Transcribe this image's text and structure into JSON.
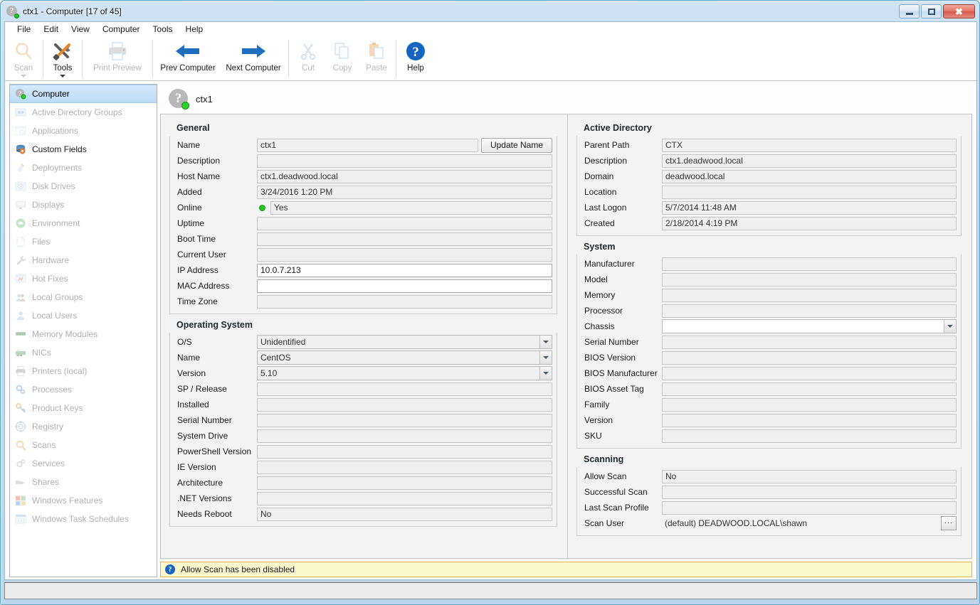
{
  "window": {
    "title": "ctx1 - Computer [17 of 45]",
    "title_icon": "computer-online-icon",
    "minimize_label": "Minimize",
    "maximize_label": "Maximize",
    "close_label": "Close"
  },
  "menu": {
    "items": [
      {
        "label": "File"
      },
      {
        "label": "Edit"
      },
      {
        "label": "View"
      },
      {
        "label": "Computer"
      },
      {
        "label": "Tools"
      },
      {
        "label": "Help"
      }
    ]
  },
  "toolbar": {
    "buttons": [
      {
        "label": "Scan",
        "icon": "magnifier-icon",
        "enabled": false,
        "dropdown": true
      },
      {
        "label": "Tools",
        "icon": "tools-icon",
        "enabled": true,
        "dropdown": true
      },
      {
        "label": "Print Preview",
        "icon": "printer-icon",
        "enabled": false,
        "dropdown": false
      },
      {
        "label": "Prev Computer",
        "icon": "arrow-left-icon",
        "enabled": true,
        "dropdown": false
      },
      {
        "label": "Next Computer",
        "icon": "arrow-right-icon",
        "enabled": true,
        "dropdown": false
      },
      {
        "label": "Cut",
        "icon": "scissors-icon",
        "enabled": false,
        "dropdown": false
      },
      {
        "label": "Copy",
        "icon": "copy-icon",
        "enabled": false,
        "dropdown": false
      },
      {
        "label": "Paste",
        "icon": "paste-icon",
        "enabled": false,
        "dropdown": false
      },
      {
        "label": "Help",
        "icon": "question-mark-icon",
        "enabled": true,
        "dropdown": false
      }
    ]
  },
  "sidebar": {
    "items": [
      {
        "label": "Computer",
        "icon": "computer-icon",
        "enabled": true,
        "selected": true
      },
      {
        "label": "Active Directory Groups",
        "icon": "ad-groups-icon",
        "enabled": false,
        "selected": false
      },
      {
        "label": "Applications",
        "icon": "applications-icon",
        "enabled": false,
        "selected": false
      },
      {
        "label": "Custom Fields",
        "icon": "custom-fields-icon",
        "enabled": true,
        "selected": false
      },
      {
        "label": "Deployments",
        "icon": "deployments-icon",
        "enabled": false,
        "selected": false
      },
      {
        "label": "Disk Drives",
        "icon": "disk-drives-icon",
        "enabled": false,
        "selected": false
      },
      {
        "label": "Displays",
        "icon": "display-icon",
        "enabled": false,
        "selected": false
      },
      {
        "label": "Environment",
        "icon": "environment-icon",
        "enabled": false,
        "selected": false
      },
      {
        "label": "Files",
        "icon": "file-icon",
        "enabled": false,
        "selected": false
      },
      {
        "label": "Hardware",
        "icon": "wrench-icon",
        "enabled": false,
        "selected": false
      },
      {
        "label": "Hot Fixes",
        "icon": "hotfix-icon",
        "enabled": false,
        "selected": false
      },
      {
        "label": "Local Groups",
        "icon": "local-groups-icon",
        "enabled": false,
        "selected": false
      },
      {
        "label": "Local Users",
        "icon": "local-user-icon",
        "enabled": false,
        "selected": false
      },
      {
        "label": "Memory Modules",
        "icon": "memory-module-icon",
        "enabled": false,
        "selected": false
      },
      {
        "label": "NICs",
        "icon": "network-card-icon",
        "enabled": false,
        "selected": false
      },
      {
        "label": "Printers (local)",
        "icon": "printer-icon",
        "enabled": false,
        "selected": false
      },
      {
        "label": "Processes",
        "icon": "processes-icon",
        "enabled": false,
        "selected": false
      },
      {
        "label": "Product Keys",
        "icon": "product-key-icon",
        "enabled": false,
        "selected": false
      },
      {
        "label": "Registry",
        "icon": "registry-icon",
        "enabled": false,
        "selected": false
      },
      {
        "label": "Scans",
        "icon": "magnifier-icon",
        "enabled": false,
        "selected": false
      },
      {
        "label": "Services",
        "icon": "services-gear-icon",
        "enabled": false,
        "selected": false
      },
      {
        "label": "Shares",
        "icon": "shares-icon",
        "enabled": false,
        "selected": false
      },
      {
        "label": "Windows Features",
        "icon": "windows-features-icon",
        "enabled": false,
        "selected": false
      },
      {
        "label": "Windows Task Schedules",
        "icon": "task-schedule-icon",
        "enabled": false,
        "selected": false
      }
    ]
  },
  "header": {
    "computer_name": "ctx1",
    "icon": "computer-online-icon",
    "online": true
  },
  "general": {
    "title": "General",
    "update_name_label": "Update Name",
    "fields": [
      {
        "label": "Name",
        "value": "ctx1",
        "kind": "text",
        "editable": false
      },
      {
        "label": "Description",
        "value": "",
        "kind": "text",
        "editable": false
      },
      {
        "label": "Host Name",
        "value": "ctx1.deadwood.local",
        "kind": "text",
        "editable": false
      },
      {
        "label": "Added",
        "value": "3/24/2016 1:20 PM",
        "kind": "text",
        "editable": false
      },
      {
        "label": "Online",
        "value": "Yes",
        "kind": "status",
        "editable": false
      },
      {
        "label": "Uptime",
        "value": "",
        "kind": "text",
        "editable": false
      },
      {
        "label": "Boot Time",
        "value": "",
        "kind": "text",
        "editable": false
      },
      {
        "label": "Current User",
        "value": "",
        "kind": "text",
        "editable": false
      },
      {
        "label": "IP Address",
        "value": "10.0.7.213",
        "kind": "text",
        "editable": true
      },
      {
        "label": "MAC Address",
        "value": "",
        "kind": "text",
        "editable": true
      },
      {
        "label": "Time Zone",
        "value": "",
        "kind": "text",
        "editable": false
      }
    ]
  },
  "operating_system": {
    "title": "Operating System",
    "fields": [
      {
        "label": "O/S",
        "value": "Unidentified",
        "kind": "combo"
      },
      {
        "label": "Name",
        "value": "CentOS",
        "kind": "combo"
      },
      {
        "label": "Version",
        "value": "5.10",
        "kind": "combo"
      },
      {
        "label": "SP / Release",
        "value": "",
        "kind": "text"
      },
      {
        "label": "Installed",
        "value": "",
        "kind": "text"
      },
      {
        "label": "Serial Number",
        "value": "",
        "kind": "text"
      },
      {
        "label": "System Drive",
        "value": "",
        "kind": "text"
      },
      {
        "label": "PowerShell Version",
        "value": "",
        "kind": "text"
      },
      {
        "label": "IE Version",
        "value": "",
        "kind": "text"
      },
      {
        "label": "Architecture",
        "value": "",
        "kind": "text"
      },
      {
        "label": ".NET Versions",
        "value": "",
        "kind": "text"
      },
      {
        "label": "Needs Reboot",
        "value": "No",
        "kind": "text"
      }
    ]
  },
  "active_directory": {
    "title": "Active Directory",
    "fields": [
      {
        "label": "Parent Path",
        "value": "CTX",
        "kind": "text"
      },
      {
        "label": "Description",
        "value": "ctx1.deadwood.local",
        "kind": "text"
      },
      {
        "label": "Domain",
        "value": "deadwood.local",
        "kind": "text"
      },
      {
        "label": "Location",
        "value": "",
        "kind": "text"
      },
      {
        "label": "Last Logon",
        "value": "5/7/2014 11:48 AM",
        "kind": "text"
      },
      {
        "label": "Created",
        "value": "2/18/2014 4:19 PM",
        "kind": "text"
      }
    ]
  },
  "system": {
    "title": "System",
    "fields": [
      {
        "label": "Manufacturer",
        "value": "",
        "kind": "text"
      },
      {
        "label": "Model",
        "value": "",
        "kind": "text"
      },
      {
        "label": "Memory",
        "value": "",
        "kind": "text"
      },
      {
        "label": "Processor",
        "value": "",
        "kind": "text"
      },
      {
        "label": "Chassis",
        "value": "",
        "kind": "combo"
      },
      {
        "label": "Serial Number",
        "value": "",
        "kind": "text"
      },
      {
        "label": "BIOS Version",
        "value": "",
        "kind": "text"
      },
      {
        "label": "BIOS Manufacturer",
        "value": "",
        "kind": "text"
      },
      {
        "label": "BIOS Asset Tag",
        "value": "",
        "kind": "text"
      },
      {
        "label": "Family",
        "value": "",
        "kind": "text"
      },
      {
        "label": "Version",
        "value": "",
        "kind": "text"
      },
      {
        "label": "SKU",
        "value": "",
        "kind": "text"
      }
    ]
  },
  "scanning": {
    "title": "Scanning",
    "browse_label": "...",
    "fields": [
      {
        "label": "Allow Scan",
        "value": "No",
        "kind": "text"
      },
      {
        "label": "Successful Scan",
        "value": "",
        "kind": "text"
      },
      {
        "label": "Last Scan Profile",
        "value": "",
        "kind": "text"
      },
      {
        "label": "Scan User",
        "value": "(default) DEADWOOD.LOCAL\\shawn",
        "kind": "browse"
      }
    ]
  },
  "notice": {
    "icon": "question-mark-icon",
    "text": "Allow Scan has been disabled"
  },
  "colors": {
    "accent": "#1565c0",
    "online_green": "#25c425",
    "notice_bg": "#fcf8cd",
    "notice_border": "#e8b54e",
    "selection": "#bcdcf6"
  }
}
